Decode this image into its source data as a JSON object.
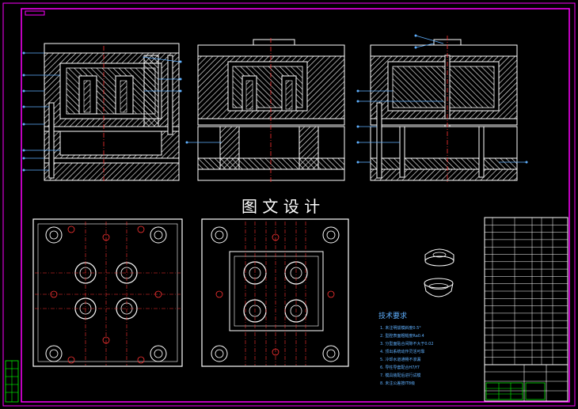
{
  "drawing": {
    "watermark": "图 文 设 计"
  },
  "tech_notes": {
    "title": "技术要求",
    "items": [
      "1. 未注明拔模斜度0.5°",
      "2. 型腔表面粗糙度Ra0.4",
      "3. 分型面贴合间隙不大于0.02",
      "4. 顶出系统动作灵活可靠",
      "5. 冷却水道通畅不渗漏",
      "6. 导柱导套配合H7/f7",
      "7. 模具装配后进行试模",
      "8. 未注公差按IT8级"
    ]
  },
  "colors": {
    "background": "#000000",
    "frame": "#ff00ff",
    "line": "#ffffff",
    "hatch": "#ffffff",
    "leader": "#5fb0ff",
    "center": "#ff3333",
    "note_text": "#5fb0ff",
    "title_block_accent": "#00ff00",
    "dim": "#ffff00"
  }
}
